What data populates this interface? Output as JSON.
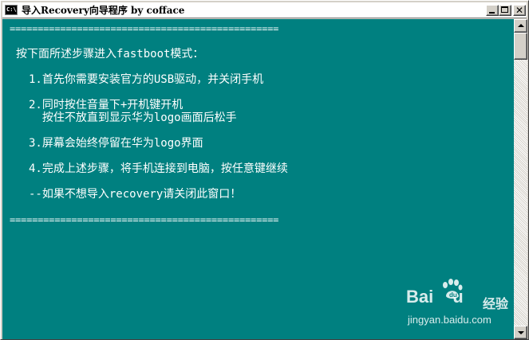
{
  "window": {
    "icon_text": "C:\\",
    "title": "导入Recovery向导程序 by cofface",
    "close_glyph": "✕"
  },
  "console": {
    "separator": "================================================",
    "lines": [
      "按下面所述步骤进入fastboot模式：",
      "1.首先你需要安装官方的USB驱动，并关闭手机",
      "2.同时按住音量下+开机键开机",
      "  按住不放直到显示华为logo画面后松手",
      "3.屏幕会始终停留在华为logo界面",
      "4.完成上述步骤，将手机连接到电脑，按任意键继续",
      "--如果不想导入recovery请关闭此窗口！"
    ],
    "text_color": "#ffffff",
    "background_color": "#008080"
  },
  "watermark": {
    "logo_left": "Bai",
    "logo_right": "u",
    "logo_suffix": "经验",
    "url": "jingyan.baidu.com"
  }
}
